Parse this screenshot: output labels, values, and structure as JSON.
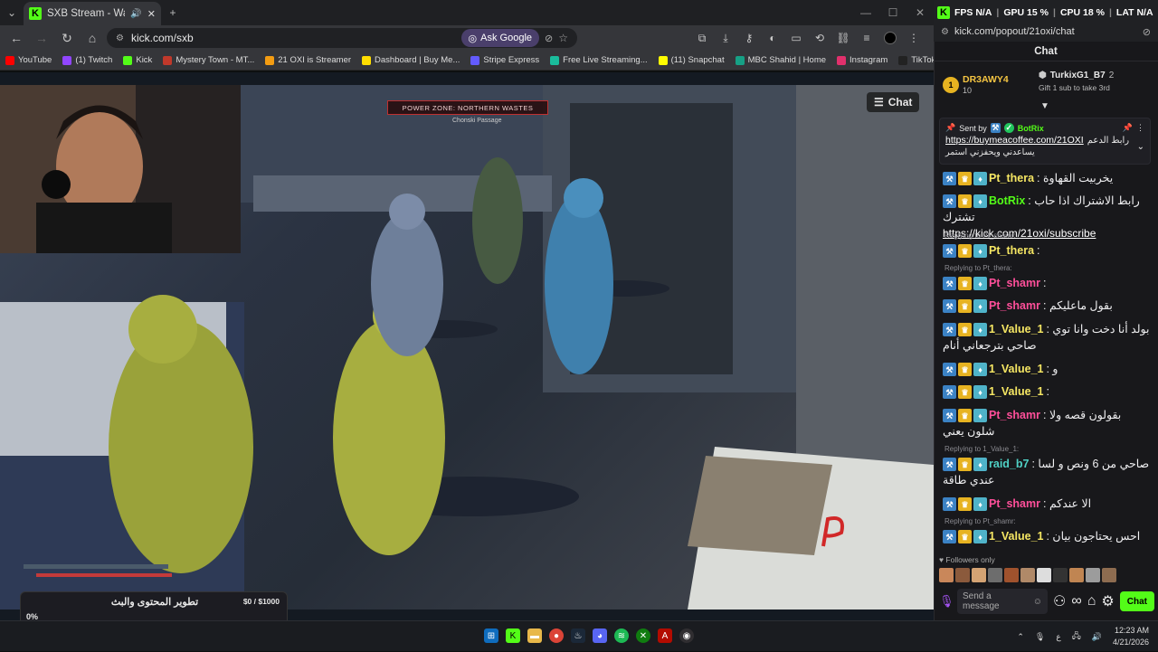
{
  "browser": {
    "tab_title": "SXB Stream - Watch Live on Kick",
    "url": "kick.com/sxb",
    "ask_google": "Ask Google",
    "bookmarks": [
      {
        "label": "YouTube",
        "color": "#ff0000"
      },
      {
        "label": "(1) Twitch",
        "color": "#9146ff"
      },
      {
        "label": "Kick",
        "color": "#53fc18"
      },
      {
        "label": "Mystery Town - MT...",
        "color": "#c0392b"
      },
      {
        "label": "21 OXI is Streamer",
        "color": "#f39c12"
      },
      {
        "label": "Dashboard | Buy Me...",
        "color": "#ffdd00"
      },
      {
        "label": "Stripe Express",
        "color": "#635bff"
      },
      {
        "label": "Free Live Streaming...",
        "color": "#1abc9c"
      },
      {
        "label": "(11) Snapchat",
        "color": "#fffc00"
      },
      {
        "label": "MBC Shahid | Home",
        "color": "#16a085"
      },
      {
        "label": "Instagram",
        "color": "#e1306c"
      },
      {
        "label": "TikTok - Make Your...",
        "color": "#222222"
      }
    ]
  },
  "stream": {
    "chat_toggle": "Chat",
    "power_zone": "POWER ZONE: NORTHERN WASTES",
    "zone_sub": "Chonski Passage",
    "goal": {
      "title": "تطوير المحتوى والبث",
      "amount": "$0 / $1000",
      "percent": "0%"
    }
  },
  "chat_window": {
    "stats": {
      "fps": "FPS N/A",
      "gpu": "GPU 15 %",
      "cpu": "CPU 18 %",
      "lat": "LAT N/A"
    },
    "url": "kick.com/popout/21oxi/chat",
    "header": "Chat",
    "leaderboard": [
      {
        "name": "DR3AWY4",
        "value": "10"
      },
      {
        "name": "TurkixG1_B7",
        "value": "2",
        "note": "Gift 1 sub to take 3rd"
      }
    ],
    "pinned": {
      "sent_by": "Sent by",
      "sender": "BotRix",
      "link": "https://buymeacoffee.com/21OXI",
      "text": "رابط الدعم",
      "text2": "يساعدني ويحفزني استمر"
    },
    "messages": [
      {
        "user": "Pt_thera",
        "color": "#f5e663",
        "text": "يخربيت القهاوة"
      },
      {
        "user": "BotRix",
        "color": "#53fc18",
        "text": "رابط الاشتراك اذا حاب تشترك",
        "link": "https://kick.com/21oxi/subscribe"
      },
      {
        "reply": "Replying to Pt_shamr:",
        "user": "Pt_thera",
        "color": "#f5e663",
        "text": ""
      },
      {
        "reply": "Replying to Pt_thera:",
        "user": "Pt_shamr",
        "color": "#ff4f9a",
        "text": ""
      },
      {
        "user": "Pt_shamr",
        "color": "#ff4f9a",
        "text": "بقول ماعليكم"
      },
      {
        "user": "1_Value_1",
        "color": "#f5e663",
        "text": "بولد أنا دخت وانا توي صاحي بترجعاني أنام"
      },
      {
        "user": "1_Value_1",
        "color": "#f5e663",
        "text": "و"
      },
      {
        "user": "1_Value_1",
        "color": "#f5e663",
        "text": ""
      },
      {
        "user": "Pt_shamr",
        "color": "#ff4f9a",
        "text": "بقولون قصه ولا شلون يعني"
      },
      {
        "reply": "Replying to 1_Value_1:",
        "user": "raid_b7",
        "color": "#4fd1c5",
        "text": "صاحي من 6 ونص و لسا عندي طاقة"
      },
      {
        "user": "Pt_shamr",
        "color": "#ff4f9a",
        "text": "الا عندكم"
      },
      {
        "reply": "Replying to Pt_shamr:",
        "user": "1_Value_1",
        "color": "#f5e663",
        "text": "احس يحتاجون بيان"
      }
    ],
    "followers_only": "Followers only",
    "send_placeholder": "Send a message",
    "chat_button": "Chat"
  },
  "taskbar": {
    "time": "12:23 AM",
    "date": "4/21/2026",
    "lang": "ع"
  }
}
